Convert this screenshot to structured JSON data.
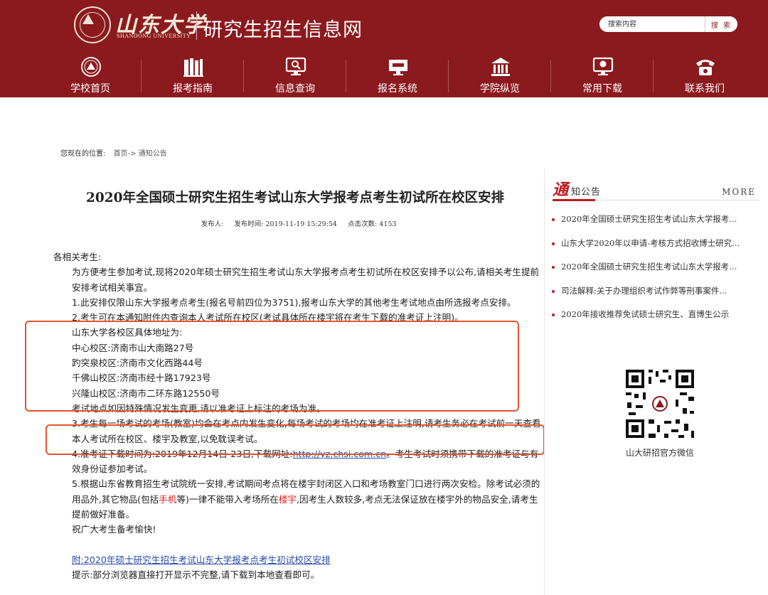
{
  "header": {
    "logo_cn": "山东大学",
    "logo_en": "SHANDONG UNIVERSITY",
    "site_title": "研究生招生信息网",
    "search": {
      "placeholder": "搜索内容",
      "button_label": "搜 索"
    },
    "nav": [
      {
        "label": "学校首页",
        "icon": "seal-icon"
      },
      {
        "label": "报考指南",
        "icon": "books-icon"
      },
      {
        "label": "信息查询",
        "icon": "monitor-search-icon"
      },
      {
        "label": "报名系统",
        "icon": "signup-board-icon"
      },
      {
        "label": "学院纵览",
        "icon": "building-icon"
      },
      {
        "label": "常用下载",
        "icon": "download-monitor-icon"
      },
      {
        "label": "联系我们",
        "icon": "phone-icon"
      }
    ]
  },
  "breadcrumb": {
    "label": "您现在的位置:",
    "path": "首页-> 通知公告"
  },
  "article": {
    "title": "2020年全国硕士研究生招生考试山东大学报考点考生初试所在校区安排",
    "meta": {
      "publisher": "发布人:",
      "time": "发布时间: 2019-11-19 15:29:54",
      "clicks": "点击次数: 4153"
    },
    "greeting": "各相关考生:",
    "intro": "为方便考生参加考试,现将2020年硕士研究生招生考试山东大学报考点考生初试所在校区安排予以公布,请相关考生提前安排考试相关事宜。",
    "item1": "1.此安排仅限山东大学报考点考生(报名号前四位为3751),报考山东大学的其他考生考试地点由所选报考点安排。",
    "item2": "2.考生可在本通知附件内查询本人考试所在校区(考试具体所在楼宇将在考生下载的准考证上注明)。",
    "campus_heading": "山东大学各校区具体地址为:",
    "campuses": [
      "中心校区:济南市山大南路27号",
      "趵突泉校区:济南市文化西路44号",
      "千佛山校区:济南市经十路17923号",
      "兴隆山校区:济南市二环东路12550号"
    ],
    "change_note": "考试地点如因特殊情况发生变更,请以准考证上标注的考场为准。",
    "item3": "3.考生每一场考试的考场(教室)均会在考点内发生变化,每场考试的考场均在准考证上注明,请考生务必在考试前一天查看本人考试所在校区、楼宇及教室,以免耽误考试。",
    "item4_pre": "4.准考证下载时间为:2019年12月14日-23日,下载网址:",
    "item4_link": "http://yz.chsi.com.cn",
    "item4_post": "。考生考试时须携带下载的准考证与有效身份证参加考试。",
    "item5_a": "5.根据山东省教育招生考试院统一安排,考试期间考点将在楼宇封闭区入口和考场教室门口进行两次安检。除考试必须的用品外,其它物品(包括",
    "item5_phone": "手机",
    "item5_b": "等)一律不能带入考场所在",
    "item5_building": "楼宇",
    "item5_c": ",因考生人数较多,考点无法保证放在楼宇外的物品安全,请考生提前做好准备。",
    "wish": "祝广大考生备考愉快!",
    "attachment": "附:2020年硕士研究生招生考试山东大学报考点考生初试校区安排",
    "tip": "提示:部分浏览器直接打开显示不完整,请下载到本地查看即可。",
    "highlight_color": "#e0532f"
  },
  "sidebar": {
    "heading_big": "通",
    "heading_rest": "知公告",
    "more": "MORE",
    "news": [
      "2020年全国硕士研究生招生考试山东大学报考...",
      "山东大学2020年以申请-考核方式招收博士研究...",
      "2020年全国硕士研究生招生考试山东大学报考...",
      "司法解释:关于办理组织考试作弊等刑事案件...",
      "2020年接收推荐免试硕士研究生、直博生公示"
    ],
    "qr_caption": "山大研招官方微信"
  },
  "colors": {
    "brand": "#8b1a1e",
    "accent": "#c0191f",
    "link": "#2a4ca6",
    "warn": "#e4221d"
  }
}
